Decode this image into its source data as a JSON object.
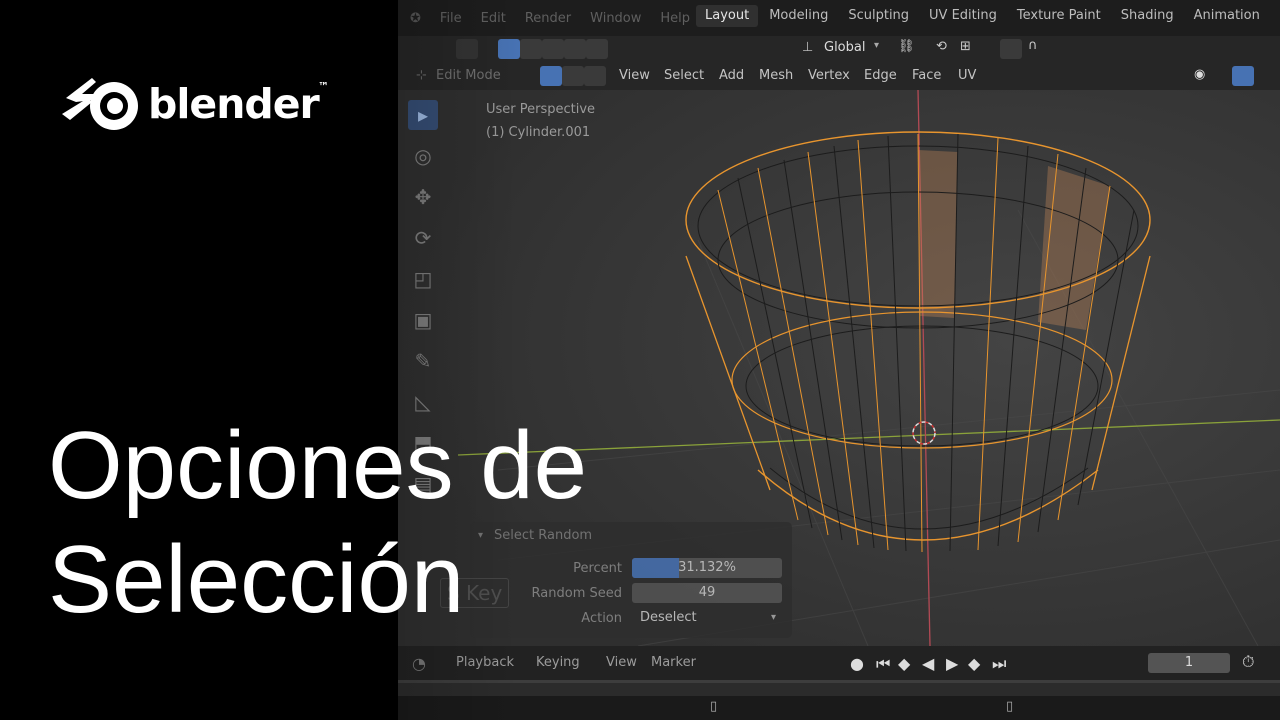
{
  "brand": {
    "name": "blender",
    "tm": "™"
  },
  "overlay_title": {
    "line1": "Opciones de",
    "line2": "Selección"
  },
  "topbar": {
    "menus": [
      "File",
      "Edit",
      "Render",
      "Window",
      "Help"
    ],
    "tabs": [
      "Layout",
      "Modeling",
      "Sculpting",
      "UV Editing",
      "Texture Paint",
      "Shading",
      "Animation"
    ],
    "active_tab": "Layout"
  },
  "toolbar": {
    "orientation": "Global"
  },
  "header": {
    "mode": "Edit Mode",
    "menus": [
      "View",
      "Select",
      "Add",
      "Mesh",
      "Vertex",
      "Edge",
      "Face",
      "UV"
    ]
  },
  "viewport": {
    "view_name": "User Perspective",
    "object_name": "(1) Cylinder.001"
  },
  "operator_panel": {
    "title": "Select Random",
    "percent_label": "Percent",
    "percent_value": "31.132%",
    "percent_fraction": 0.31132,
    "seed_label": "Random Seed",
    "seed_value": "49",
    "action_label": "Action",
    "action_value": "Deselect",
    "key_hint": "S Key"
  },
  "timeline": {
    "menus": [
      "Playback",
      "Keying",
      "View",
      "Marker"
    ],
    "current_frame": "1"
  },
  "colors": {
    "accent": "#4772b3",
    "selection": "#f5a623",
    "background": "#3c3c3c"
  }
}
